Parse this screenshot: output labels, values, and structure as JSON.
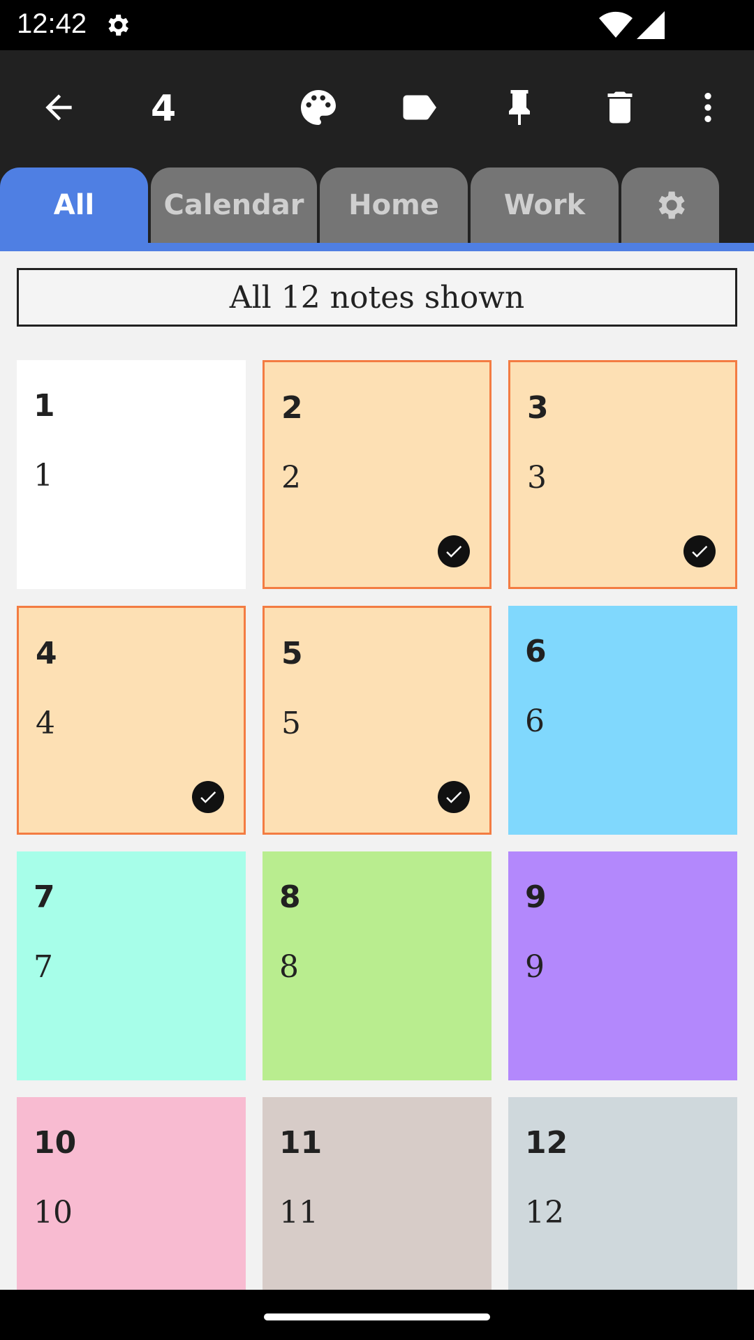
{
  "status": {
    "time": "12:42"
  },
  "toolbar": {
    "selected_count": "4"
  },
  "tabs": [
    {
      "label": "All"
    },
    {
      "label": "Calendar"
    },
    {
      "label": "Home"
    },
    {
      "label": "Work"
    }
  ],
  "banner": {
    "text": "All 12 notes shown"
  },
  "notes": [
    {
      "title": "1",
      "body": "1",
      "color": "#ffffff",
      "selected": false
    },
    {
      "title": "2",
      "body": "2",
      "color": "#fde0b4",
      "selected": true
    },
    {
      "title": "3",
      "body": "3",
      "color": "#fde0b4",
      "selected": true
    },
    {
      "title": "4",
      "body": "4",
      "color": "#fde0b4",
      "selected": true
    },
    {
      "title": "5",
      "body": "5",
      "color": "#fde0b4",
      "selected": true
    },
    {
      "title": "6",
      "body": "6",
      "color": "#80d8fd",
      "selected": false
    },
    {
      "title": "7",
      "body": "7",
      "color": "#a7fee9",
      "selected": false
    },
    {
      "title": "8",
      "body": "8",
      "color": "#b9ed8f",
      "selected": false
    },
    {
      "title": "9",
      "body": "9",
      "color": "#b388fc",
      "selected": false
    },
    {
      "title": "10",
      "body": "10",
      "color": "#f8bbd1",
      "selected": false
    },
    {
      "title": "11",
      "body": "11",
      "color": "#d7ccc8",
      "selected": false
    },
    {
      "title": "12",
      "body": "12",
      "color": "#cfd8dc",
      "selected": false
    }
  ],
  "colors": {
    "accent": "#4f7fe3",
    "selection_border": "#f37c42",
    "toolbar": "#212121"
  }
}
